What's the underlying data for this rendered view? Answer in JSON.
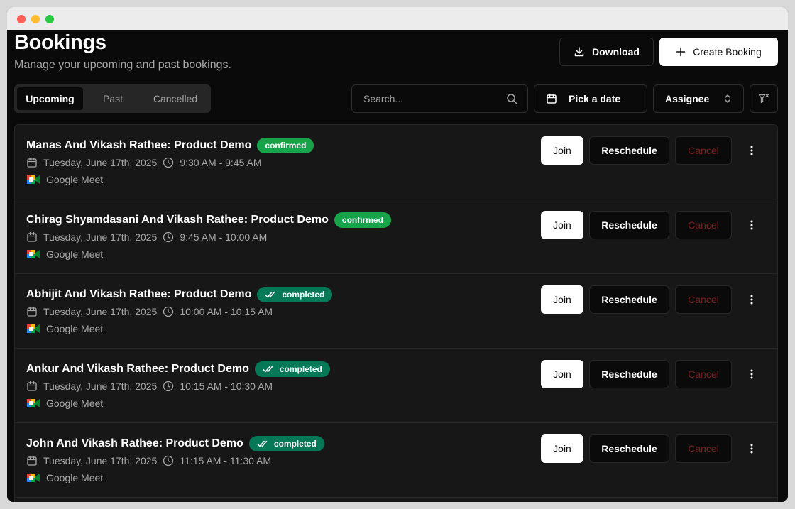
{
  "header": {
    "title": "Bookings",
    "subtitle": "Manage your upcoming and past bookings.",
    "download_label": "Download",
    "create_label": "Create Booking"
  },
  "tabs": [
    {
      "label": "Upcoming",
      "active": true
    },
    {
      "label": "Past",
      "active": false
    },
    {
      "label": "Cancelled",
      "active": false
    }
  ],
  "search": {
    "placeholder": "Search...",
    "value": ""
  },
  "filters": {
    "date_label": "Pick a date",
    "assignee_label": "Assignee"
  },
  "row_actions": {
    "join": "Join",
    "reschedule": "Reschedule",
    "cancel": "Cancel"
  },
  "bookings": [
    {
      "title": "Manas And Vikash Rathee: Product Demo",
      "status": "confirmed",
      "date": "Tuesday, June 17th, 2025",
      "time": "9:30 AM - 9:45 AM",
      "location": "Google Meet"
    },
    {
      "title": "Chirag Shyamdasani And Vikash Rathee: Product Demo",
      "status": "confirmed",
      "date": "Tuesday, June 17th, 2025",
      "time": "9:45 AM - 10:00 AM",
      "location": "Google Meet"
    },
    {
      "title": "Abhijit And Vikash Rathee: Product Demo",
      "status": "completed",
      "date": "Tuesday, June 17th, 2025",
      "time": "10:00 AM - 10:15 AM",
      "location": "Google Meet"
    },
    {
      "title": "Ankur And Vikash Rathee: Product Demo",
      "status": "completed",
      "date": "Tuesday, June 17th, 2025",
      "time": "10:15 AM - 10:30 AM",
      "location": "Google Meet"
    },
    {
      "title": "John And Vikash Rathee: Product Demo",
      "status": "completed",
      "date": "Tuesday, June 17th, 2025",
      "time": "11:15 AM - 11:30 AM",
      "location": "Google Meet"
    }
  ],
  "colors": {
    "confirmed": "#16a34a",
    "completed": "#047857",
    "cancel_text": "#7f1d1d"
  }
}
